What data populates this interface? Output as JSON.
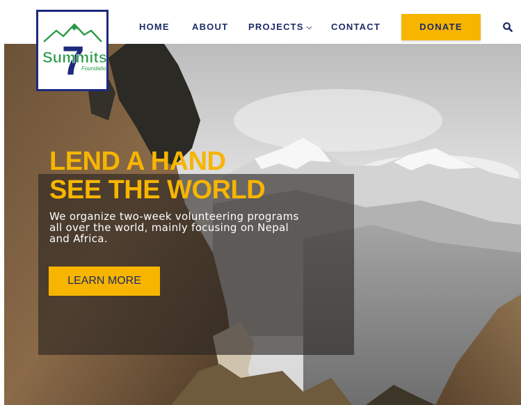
{
  "logo": {
    "number": "7",
    "name": "Summits",
    "sub": "Foundation"
  },
  "nav": {
    "home": "HOME",
    "about": "ABOUT",
    "projects": "PROJECTS",
    "contact": "CONTACT",
    "donate": "DONATE"
  },
  "hero": {
    "title_line1": "LEND A HAND",
    "title_line2": "SEE THE WORLD",
    "description": "We organize two-week volunteering programs all over the world, mainly focusing on Nepal and Africa.",
    "cta": "LEARN MORE"
  },
  "colors": {
    "navy": "#1d2b66",
    "accent_yellow": "#f7b500",
    "logo_green": "#2a9a4a"
  },
  "icons": {
    "search": "search-icon",
    "projects_dropdown": "chevron-down-icon"
  }
}
